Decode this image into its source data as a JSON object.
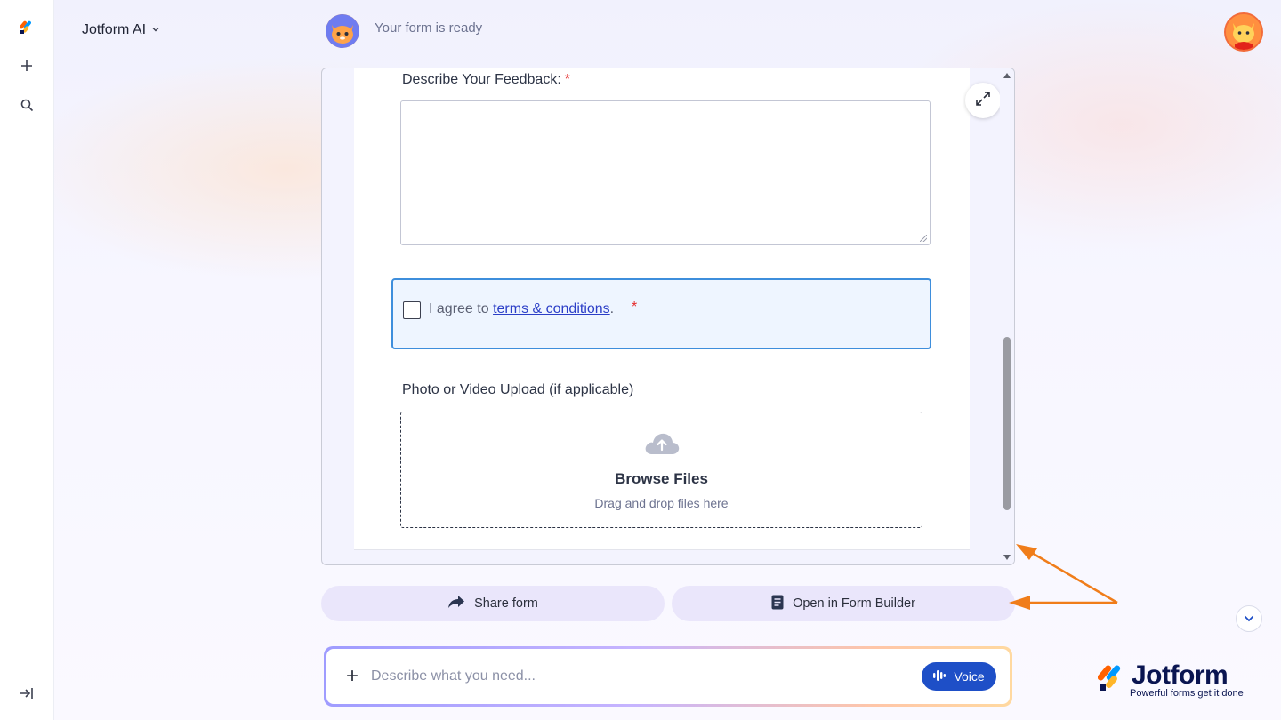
{
  "sidebar": {
    "logo_icon": "jotform-logo-icon",
    "new_icon": "plus-icon",
    "search_icon": "search-icon",
    "collapse_icon": "sidebar-collapse-icon"
  },
  "header": {
    "brand_title": "Jotform AI",
    "message": "Your form is ready"
  },
  "form": {
    "feedback_label": "Describe Your Feedback:",
    "required_mark": "*",
    "agree_prefix": "I agree to",
    "terms_link": "terms & conditions",
    "agree_suffix": ".",
    "upload_label": "Photo or Video Upload (if applicable)",
    "upload_title": "Browse Files",
    "upload_hint": "Drag and drop files here"
  },
  "actions": {
    "share": "Share form",
    "open_builder": "Open in Form Builder"
  },
  "chat": {
    "placeholder": "Describe what you need...",
    "voice": "Voice"
  },
  "branding": {
    "logo_word": "Jotform",
    "logo_tagline": "Powerful forms get it done"
  },
  "colors": {
    "accent": "#1e4fc7",
    "annotation_arrow": "#f07d1a",
    "required": "#e52b2b"
  }
}
